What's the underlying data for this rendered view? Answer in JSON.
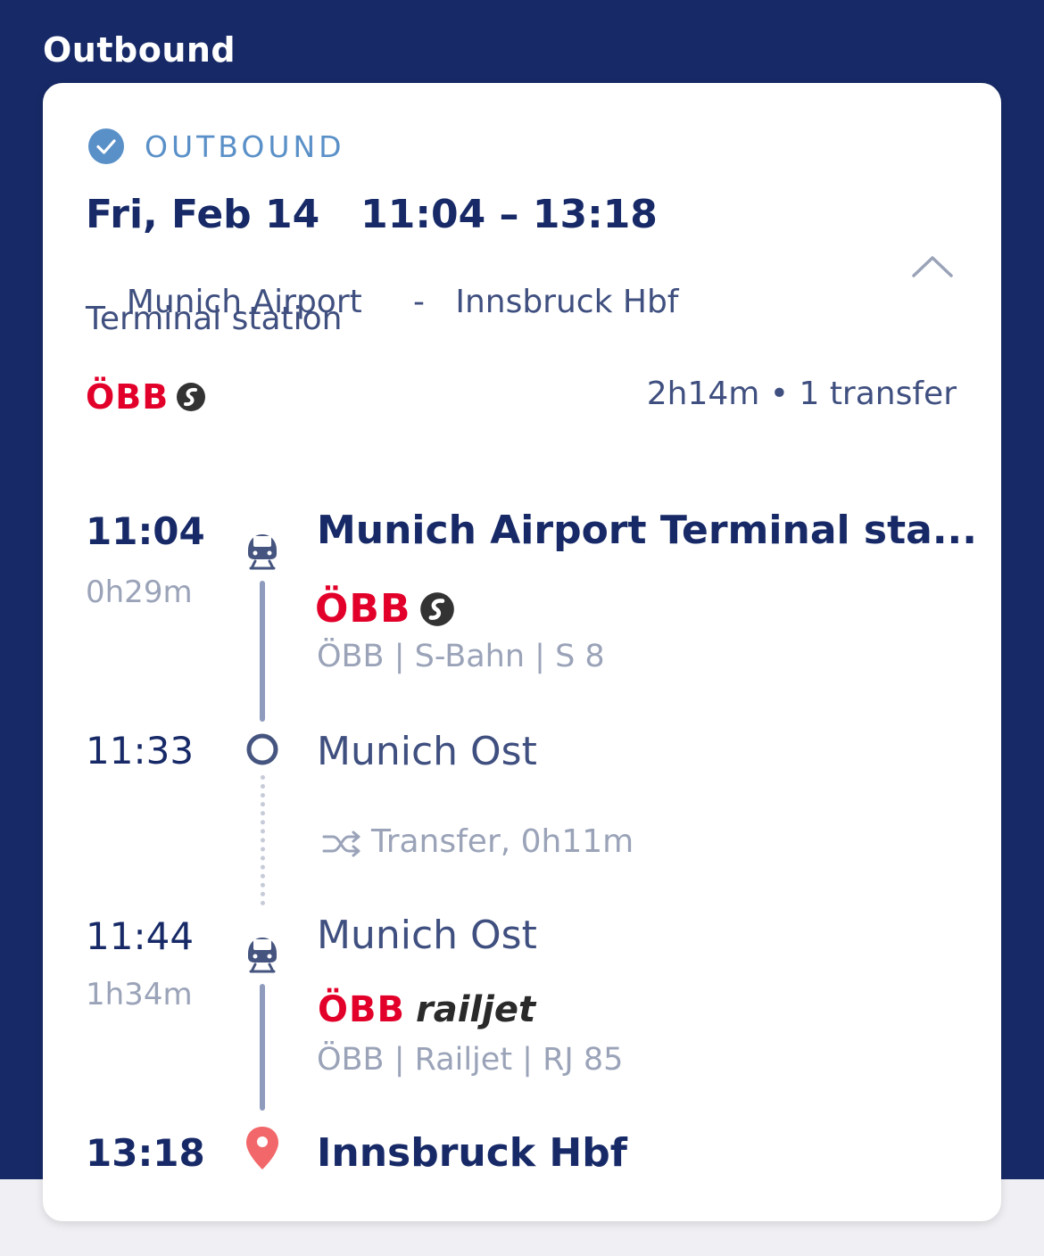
{
  "header": {
    "title": "Outbound"
  },
  "trip": {
    "badge": "OUTBOUND",
    "date_time": "Fri, Feb 14   11:04 – 13:18",
    "route_from": "Munich Airport",
    "route_sep": "-",
    "route_to": "Innsbruck Hbf",
    "route_from_line2": "Terminal station",
    "logo_text": "ÖBB",
    "summary": "2h14m • 1 transfer"
  },
  "colors": {
    "page_bg": "#172a67",
    "accent": "#5a90c8",
    "obb_red": "#e2002a",
    "pin": "#f2686a"
  },
  "timeline": {
    "seg1": {
      "time": "11:04",
      "duration": "0h29m",
      "stop": "Munich Airport Terminal sta...",
      "logo_text": "ÖBB",
      "carrier": "ÖBB | S-Bahn | S 8",
      "icon": "train-icon"
    },
    "stop2": {
      "time": "11:33",
      "stop": "Munich Ost",
      "icon": "circle-icon"
    },
    "transfer": {
      "text": "Transfer, 0h11m",
      "icon": "shuffle-icon"
    },
    "seg2": {
      "time": "11:44",
      "duration": "1h34m",
      "stop": "Munich Ost",
      "logo_text": "ÖBB",
      "logo_sub": "railjet",
      "carrier": "ÖBB | Railjet | RJ 85",
      "icon": "train-icon"
    },
    "arrival": {
      "time": "13:18",
      "stop": "Innsbruck Hbf",
      "icon": "location-pin-icon"
    }
  }
}
